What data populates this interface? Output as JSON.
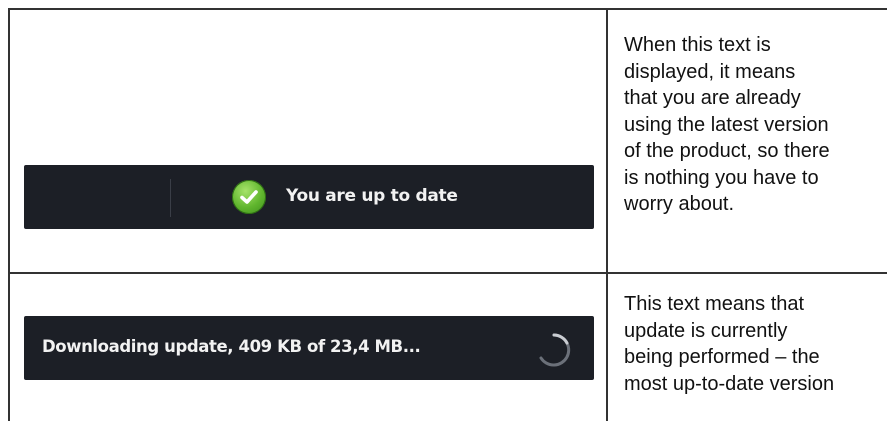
{
  "rows": [
    {
      "status_text": "You are up to date",
      "icon": "checkmark-circle-icon",
      "icon_color": "#5fb52d",
      "description": "When this text is\ndisplayed, it means\nthat you are already\nusing the latest version\nof the product, so there\nis nothing you have to\nworry about."
    },
    {
      "status_text": "Downloading update, 409 KB of 23,4 MB...",
      "icon": "loading-spinner-icon",
      "description": "This text means that\nupdate is currently\nbeing performed – the\nmost up-to-date version"
    }
  ],
  "colors": {
    "bar_background": "#1c1f26",
    "bar_text": "#f2f2f2",
    "table_border": "#333333"
  }
}
